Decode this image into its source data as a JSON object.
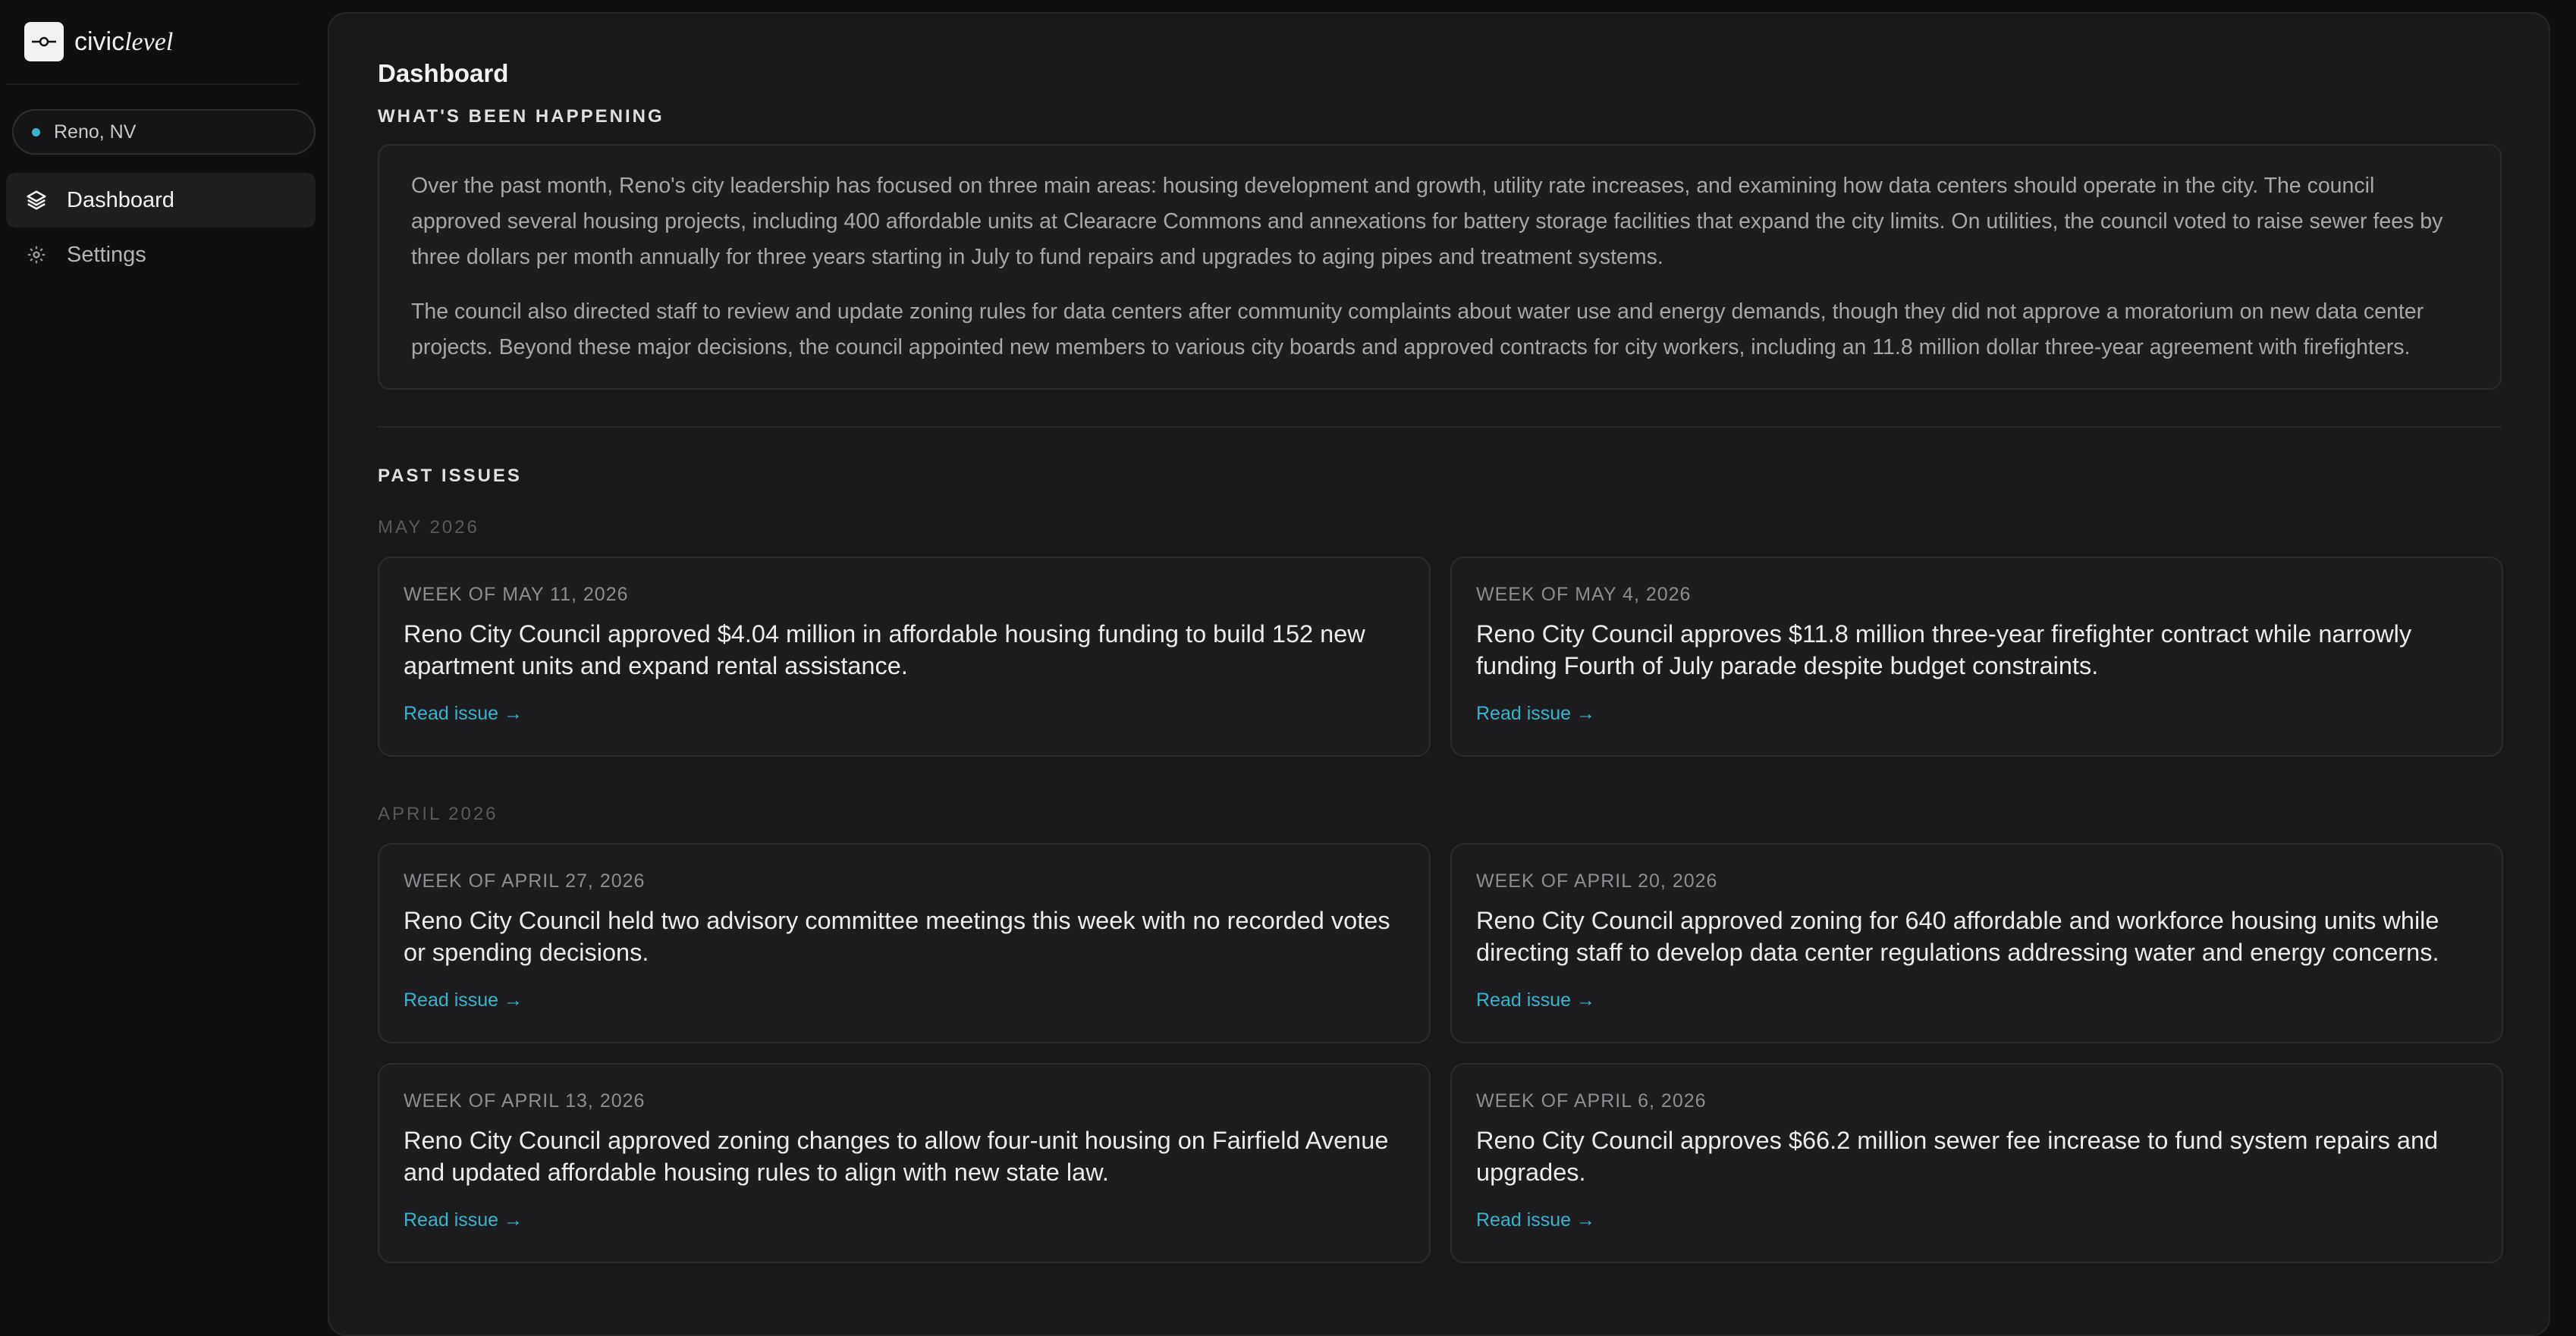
{
  "brand": {
    "name_regular": "civic",
    "name_italic": "level"
  },
  "location": {
    "label": "Reno, NV"
  },
  "nav": [
    {
      "label": "Dashboard",
      "icon": "layers-icon",
      "active": true
    },
    {
      "label": "Settings",
      "icon": "gear-icon",
      "active": false
    }
  ],
  "main": {
    "title": "Dashboard",
    "summary_heading": "WHAT'S BEEN HAPPENING",
    "summary_paragraphs": [
      "Over the past month, Reno's city leadership has focused on three main areas: housing development and growth, utility rate increases, and examining how data centers should operate in the city. The council approved several housing projects, including 400 affordable units at Clearacre Commons and annexations for battery storage facilities that expand the city limits. On utilities, the council voted to raise sewer fees by three dollars per month annually for three years starting in July to fund repairs and upgrades to aging pipes and treatment systems.",
      "The council also directed staff to review and update zoning rules for data centers after community complaints about water use and energy demands, though they did not approve a moratorium on new data center projects. Beyond these major decisions, the council appointed new members to various city boards and approved contracts for city workers, including an 11.8 million dollar three-year agreement with firefighters."
    ],
    "past_heading": "PAST ISSUES",
    "months": [
      {
        "label": "MAY 2026",
        "issues": [
          {
            "week": "WEEK OF MAY 11, 2026",
            "summary": "Reno City Council approved $4.04 million in affordable housing funding to build 152 new apartment units and expand rental assistance.",
            "link": "Read issue →"
          },
          {
            "week": "WEEK OF MAY 4, 2026",
            "summary": "Reno City Council approves $11.8 million three-year firefighter contract while narrowly funding Fourth of July parade despite budget constraints.",
            "link": "Read issue →"
          }
        ]
      },
      {
        "label": "APRIL 2026",
        "issues": [
          {
            "week": "WEEK OF APRIL 27, 2026",
            "summary": "Reno City Council held two advisory committee meetings this week with no recorded votes or spending decisions.",
            "link": "Read issue →"
          },
          {
            "week": "WEEK OF APRIL 20, 2026",
            "summary": "Reno City Council approved zoning for 640 affordable and workforce housing units while directing staff to develop data center regulations addressing water and energy concerns.",
            "link": "Read issue →"
          },
          {
            "week": "WEEK OF APRIL 13, 2026",
            "summary": "Reno City Council approved zoning changes to allow four-unit housing on Fairfield Avenue and updated affordable housing rules to align with new state law.",
            "link": "Read issue →"
          },
          {
            "week": "WEEK OF APRIL 6, 2026",
            "summary": "Reno City Council approves $66.2 million sewer fee increase to fund system repairs and upgrades.",
            "link": "Read issue →"
          }
        ]
      }
    ]
  },
  "colors": {
    "accent": "#3ab3cf",
    "background": "#0f0f10",
    "panel": "#19191a"
  }
}
